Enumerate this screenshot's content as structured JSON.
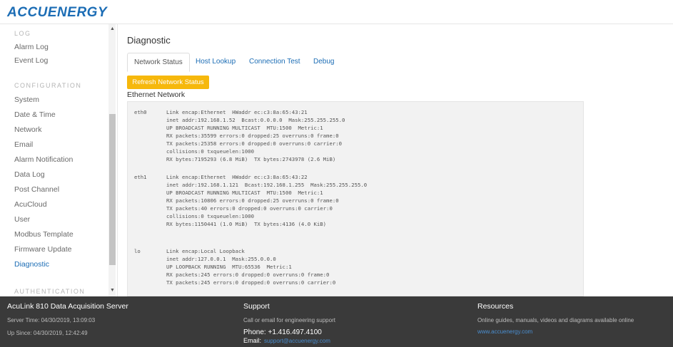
{
  "brand": {
    "logo_text": "ACCUENERGY",
    "accent": "#1c6db5"
  },
  "sidebar": {
    "sections": [
      {
        "heading": "LOG",
        "items": [
          "Alarm Log",
          "Event Log"
        ]
      },
      {
        "heading": "CONFIGURATION",
        "items": [
          "System",
          "Date & Time",
          "Network",
          "Email",
          "Alarm Notification",
          "Data Log",
          "Post Channel",
          "AcuCloud",
          "User",
          "Modbus Template",
          "Firmware Update",
          "Diagnostic"
        ]
      },
      {
        "heading": "AUTHENTICATION",
        "items": []
      }
    ],
    "active_item": "Diagnostic"
  },
  "main": {
    "title": "Diagnostic",
    "tabs": [
      {
        "label": "Network Status",
        "active": true
      },
      {
        "label": "Host Lookup",
        "active": false
      },
      {
        "label": "Connection Test",
        "active": false
      },
      {
        "label": "Debug",
        "active": false
      }
    ],
    "refresh_label": "Refresh Network Status",
    "refresh_color": "#f6b80c",
    "section_title": "Ethernet Network",
    "interfaces": [
      {
        "name": "eth0",
        "lines": [
          "Link encap:Ethernet  HWaddr ec:c3:8a:65:43:21",
          "inet addr:192.168.1.52  Bcast:0.0.0.0  Mask:255.255.255.0",
          "UP BROADCAST RUNNING MULTICAST  MTU:1500  Metric:1",
          "RX packets:35599 errors:0 dropped:25 overruns:0 frame:0",
          "TX packets:25358 errors:0 dropped:0 overruns:0 carrier:0",
          "collisions:0 txqueuelen:1000",
          "RX bytes:7195293 (6.8 MiB)  TX bytes:2743978 (2.6 MiB)"
        ]
      },
      {
        "name": "eth1",
        "lines": [
          "Link encap:Ethernet  HWaddr ec:c3:8a:65:43:22",
          "inet addr:192.168.1.121  Bcast:192.168.1.255  Mask:255.255.255.0",
          "UP BROADCAST RUNNING MULTICAST  MTU:1500  Metric:1",
          "RX packets:10806 errors:0 dropped:25 overruns:0 frame:0",
          "TX packets:40 errors:0 dropped:0 overruns:0 carrier:0",
          "collisions:0 txqueuelen:1000",
          "RX bytes:1150441 (1.0 MiB)  TX bytes:4136 (4.0 KiB)"
        ]
      },
      {
        "name": "lo",
        "lines": [
          "Link encap:Local Loopback",
          "inet addr:127.0.0.1  Mask:255.0.0.0",
          "UP LOOPBACK RUNNING  MTU:65536  Metric:1",
          "RX packets:245 errors:0 dropped:0 overruns:0 frame:0",
          "TX packets:245 errors:0 dropped:0 overruns:0 carrier:0"
        ]
      }
    ]
  },
  "footer": {
    "product": {
      "title": "AcuLink 810 Data Acquisition Server",
      "server_time": "Server Time: 04/30/2019, 13:09:03",
      "up_since": "Up Since: 04/30/2019, 12:42:49"
    },
    "support": {
      "title": "Support",
      "text": "Call or email for engineering support",
      "phone": "Phone: +1.416.497.4100",
      "email_label": "Email:",
      "email": "support@accuenergy.com"
    },
    "resources": {
      "title": "Resources",
      "text": "Online guides, manuals, videos and diagrams available online",
      "link": "www.accuenergy.com"
    }
  }
}
